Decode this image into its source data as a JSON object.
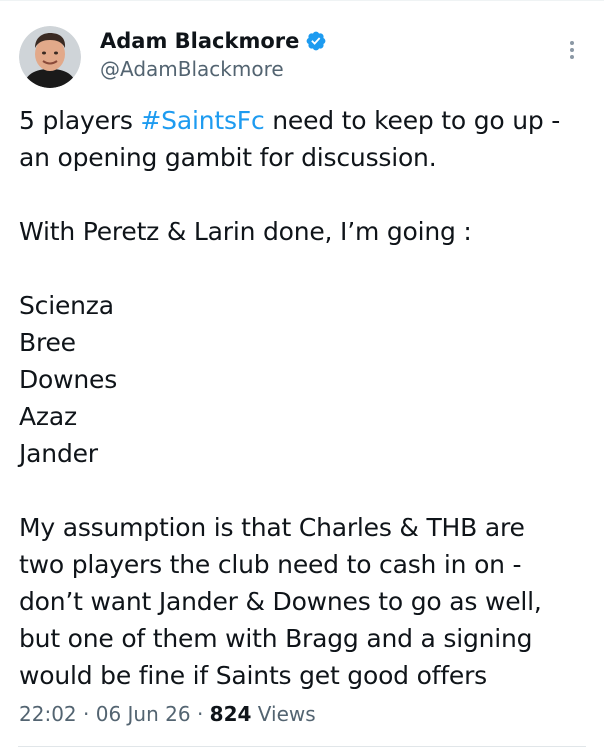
{
  "author": {
    "name": "Adam Blackmore",
    "handle": "@AdamBlackmore",
    "verified": true,
    "avatar_icon": "profile-photo"
  },
  "tweet": {
    "line1_pre": "5 players ",
    "line1_hashtag": "#SaintsFc",
    "line1_post": " need to keep to go up -",
    "line2": "an opening gambit for discussion.",
    "line3": "With Peretz & Larin done, I’m going :",
    "players": [
      "Scienza",
      "Bree",
      "Downes",
      "Azaz",
      "Jander"
    ],
    "para_lines": [
      "My assumption is that Charles & THB are",
      "two players the club need to cash in on -",
      "don’t want Jander & Downes to go as well,",
      "but one of them with Bragg and a signing",
      "would be fine if Saints get good offers"
    ]
  },
  "meta": {
    "time": "22:02",
    "sep1": "·",
    "date": "06 Jun 26",
    "sep2": "·",
    "views_count": "824",
    "views_label": "Views"
  },
  "colors": {
    "link": "#1d9bf0",
    "text": "#0f1419",
    "secondary": "#536471"
  },
  "icons": {
    "more": "more-vertical-icon",
    "verified": "verified-badge-icon"
  }
}
